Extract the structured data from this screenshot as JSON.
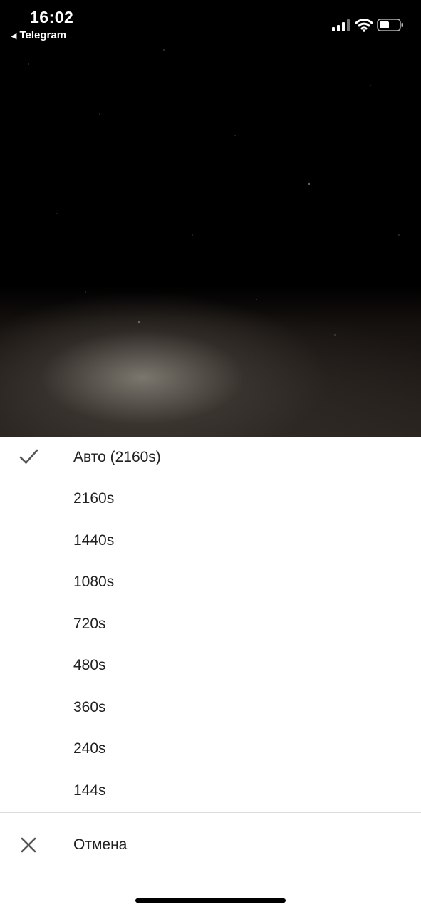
{
  "status_bar": {
    "time": "16:02",
    "back_app": "Telegram"
  },
  "quality_menu": {
    "selected_index": 0,
    "items": [
      {
        "label": "Авто (2160s)",
        "selected": true
      },
      {
        "label": "2160s",
        "selected": false
      },
      {
        "label": "1440s",
        "selected": false
      },
      {
        "label": "1080s",
        "selected": false
      },
      {
        "label": "720s",
        "selected": false
      },
      {
        "label": "480s",
        "selected": false
      },
      {
        "label": "360s",
        "selected": false
      },
      {
        "label": "240s",
        "selected": false
      },
      {
        "label": "144s",
        "selected": false
      }
    ],
    "cancel_label": "Отмена"
  },
  "icons": {
    "selected": "checkmark-icon",
    "cancel": "close-icon",
    "signal": "cellular-signal-icon",
    "wifi": "wifi-icon",
    "battery": "battery-icon",
    "back": "back-arrow-icon"
  },
  "colors": {
    "sheet_background": "#ffffff",
    "text": "#212121",
    "icon": "#555555"
  }
}
